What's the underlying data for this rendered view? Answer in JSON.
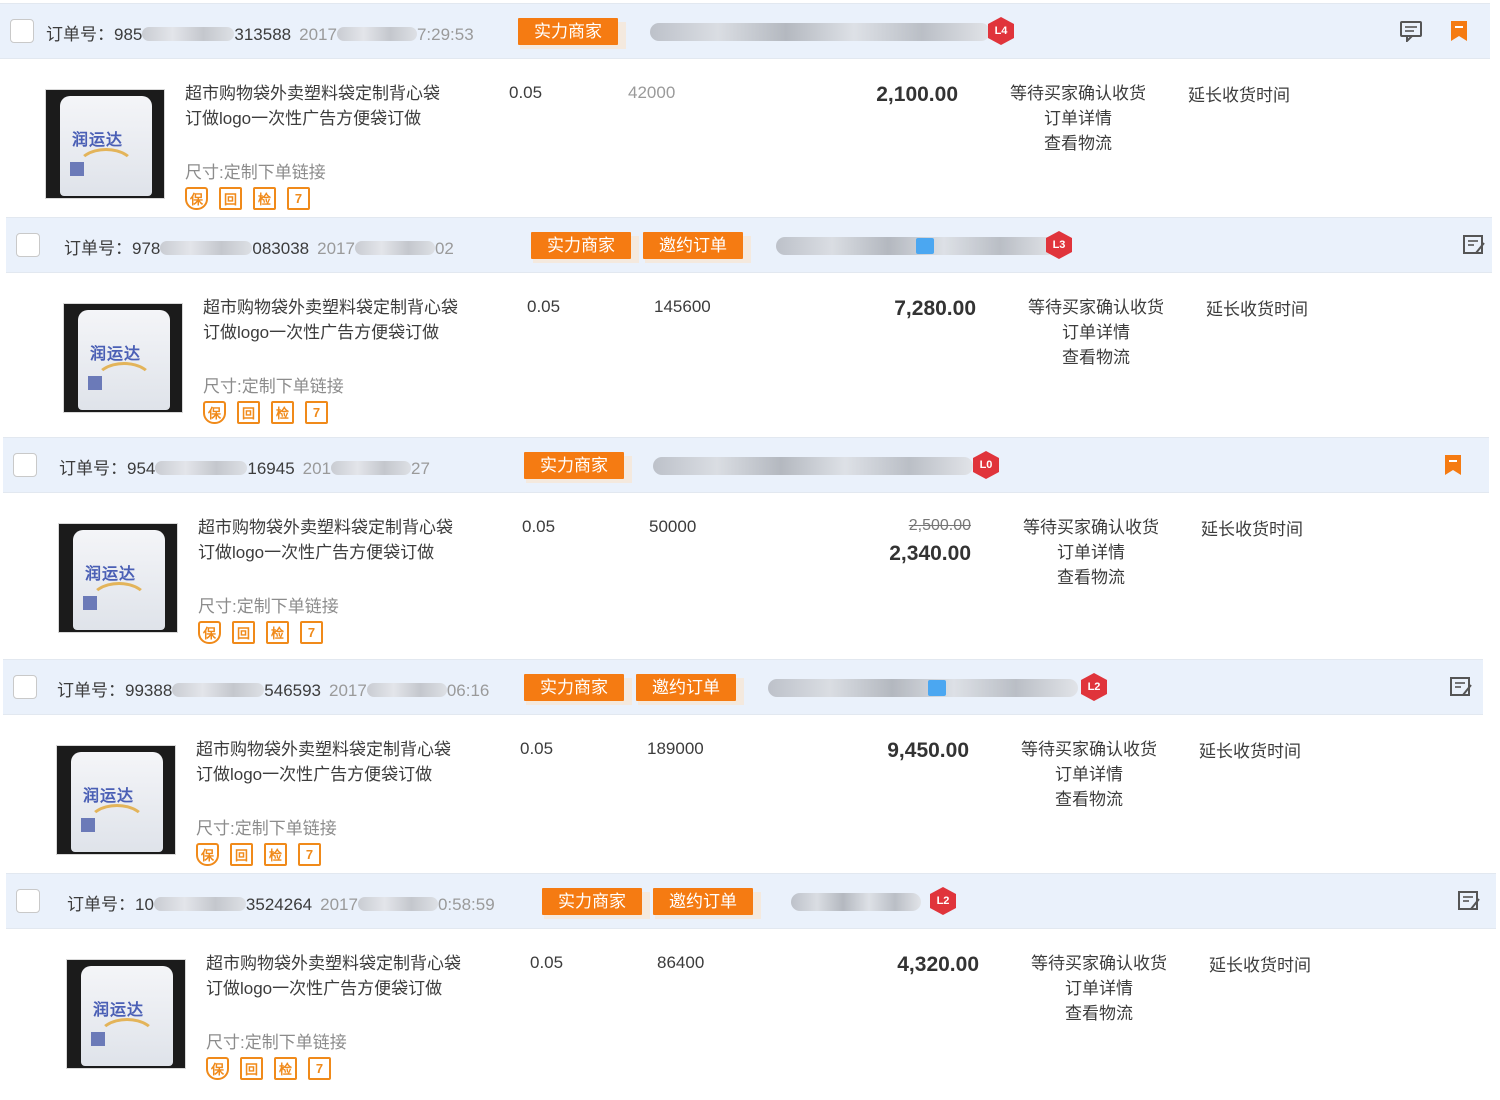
{
  "labels": {
    "order_no": "订单号：",
    "sku_prefix": "尺寸:",
    "status_waiting": "等待买家确认收货",
    "order_detail": "订单详情",
    "logistics": "查看物流",
    "extend": "延长收货时间"
  },
  "colors": {
    "accent": "#f57b12",
    "header_bg": "#eaf1fb",
    "level_badge": "#e0343b"
  },
  "orders": [
    {
      "order_no_prefix": "985",
      "order_no_suffix": "313588",
      "time_prefix": "2017",
      "time_suffix": "7:29:53",
      "tags": [
        "实力商家"
      ],
      "level": "L4",
      "header_icons": [
        "message-icon",
        "bookmark-icon"
      ],
      "product": {
        "title": "超市购物袋外卖塑料袋定制背心袋订做logo一次性广告方便袋订做",
        "sku": "定制下单链接",
        "image_text": "润运达"
      },
      "service_icons": [
        "保",
        "回",
        "检",
        "7"
      ],
      "price": "0.05",
      "quantity": "42000",
      "total": "2,100.00",
      "original_total": ""
    },
    {
      "order_no_prefix": "978",
      "order_no_suffix": "083038",
      "time_prefix": "2017",
      "time_suffix": "02",
      "tags": [
        "实力商家",
        "邀约订单"
      ],
      "level": "L3",
      "header_icons": [
        "note-icon"
      ],
      "product": {
        "title": "超市购物袋外卖塑料袋定制背心袋订做logo一次性广告方便袋订做",
        "sku": "定制下单链接",
        "image_text": "润运达"
      },
      "service_icons": [
        "保",
        "回",
        "检",
        "7"
      ],
      "price": "0.05",
      "quantity": "145600",
      "total": "7,280.00",
      "original_total": ""
    },
    {
      "order_no_prefix": "954",
      "order_no_suffix": "16945",
      "time_prefix": "201",
      "time_suffix": "27",
      "tags": [
        "实力商家"
      ],
      "level": "L0",
      "header_icons": [
        "bookmark-icon"
      ],
      "product": {
        "title": "超市购物袋外卖塑料袋定制背心袋订做logo一次性广告方便袋订做",
        "sku": "定制下单链接",
        "image_text": "润运达"
      },
      "service_icons": [
        "保",
        "回",
        "检",
        "7"
      ],
      "price": "0.05",
      "quantity": "50000",
      "total": "2,340.00",
      "original_total": "2,500.00"
    },
    {
      "order_no_prefix": "99388",
      "order_no_suffix": "546593",
      "time_prefix": "2017",
      "time_suffix": "06:16",
      "tags": [
        "实力商家",
        "邀约订单"
      ],
      "level": "L2",
      "header_icons": [
        "note-icon"
      ],
      "product": {
        "title": "超市购物袋外卖塑料袋定制背心袋订做logo一次性广告方便袋订做",
        "sku": "定制下单链接",
        "image_text": "润运达"
      },
      "service_icons": [
        "保",
        "回",
        "检",
        "7"
      ],
      "price": "0.05",
      "quantity": "189000",
      "total": "9,450.00",
      "original_total": ""
    },
    {
      "order_no_prefix": "10",
      "order_no_suffix": "3524264",
      "time_prefix": "2017",
      "time_suffix": "0:58:59",
      "tags": [
        "实力商家",
        "邀约订单"
      ],
      "level": "L2",
      "header_icons": [
        "note-icon"
      ],
      "product": {
        "title": "超市购物袋外卖塑料袋定制背心袋订做logo一次性广告方便袋订做",
        "sku": "定制下单链接",
        "image_text": "润运达"
      },
      "service_icons": [
        "保",
        "回",
        "检",
        "7"
      ],
      "price": "0.05",
      "quantity": "86400",
      "total": "4,320.00",
      "original_total": ""
    }
  ]
}
